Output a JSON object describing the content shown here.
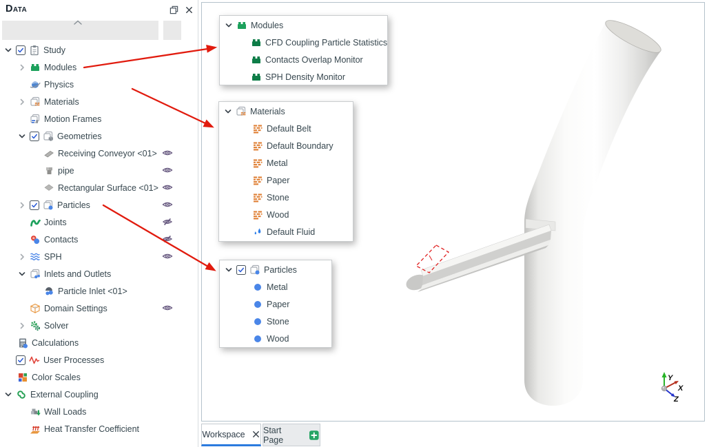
{
  "sidebar": {
    "title": "Data",
    "items": [
      {
        "label": "Study",
        "checked": true
      },
      {
        "label": "Modules"
      },
      {
        "label": "Physics"
      },
      {
        "label": "Materials"
      },
      {
        "label": "Motion Frames"
      },
      {
        "label": "Geometries",
        "checked": true
      },
      {
        "label": "Receiving Conveyor <01>",
        "eye": "visible"
      },
      {
        "label": "pipe",
        "eye": "visible"
      },
      {
        "label": "Rectangular Surface <01>",
        "eye": "visible"
      },
      {
        "label": "Particles",
        "checked": true,
        "eye": "visible"
      },
      {
        "label": "Joints",
        "eye": "hidden"
      },
      {
        "label": "Contacts",
        "eye": "hidden"
      },
      {
        "label": "SPH",
        "eye": "visible"
      },
      {
        "label": "Inlets and Outlets"
      },
      {
        "label": "Particle Inlet <01>"
      },
      {
        "label": "Domain Settings",
        "eye": "visible"
      },
      {
        "label": "Solver"
      },
      {
        "label": "Calculations"
      },
      {
        "label": "User Processes",
        "checked": true
      },
      {
        "label": "Color Scales"
      },
      {
        "label": "External Coupling"
      },
      {
        "label": "Wall Loads"
      },
      {
        "label": "Heat Transfer Coefficient"
      }
    ]
  },
  "popups": {
    "modules": {
      "title": "Modules",
      "items": [
        {
          "label": "CFD Coupling Particle Statistics"
        },
        {
          "label": "Contacts Overlap Monitor"
        },
        {
          "label": "SPH Density Monitor"
        }
      ]
    },
    "materials": {
      "title": "Materials",
      "items": [
        {
          "label": "Default Belt"
        },
        {
          "label": "Default Boundary"
        },
        {
          "label": "Metal"
        },
        {
          "label": "Paper"
        },
        {
          "label": "Stone"
        },
        {
          "label": "Wood"
        },
        {
          "label": "Default Fluid"
        }
      ]
    },
    "particles": {
      "title": "Particles",
      "checked": true,
      "items": [
        {
          "label": "Metal"
        },
        {
          "label": "Paper"
        },
        {
          "label": "Stone"
        },
        {
          "label": "Wood"
        }
      ]
    }
  },
  "tabs": [
    {
      "label": "Workspace"
    },
    {
      "label": "Start Page"
    }
  ],
  "viewport": {
    "axes": {
      "x": "X",
      "y": "Y",
      "z": "Z"
    }
  },
  "colors": {
    "module_green": "#1da15c",
    "module_green_dark": "#0e7d48",
    "material_orange": "#e0833a",
    "particle_blue": "#4a86e8",
    "arrow_red": "#e11b0e",
    "tab_accent_blue": "#2a7ade",
    "eye_purple": "#6a5c82",
    "check_blue": "#2b5cd6"
  }
}
